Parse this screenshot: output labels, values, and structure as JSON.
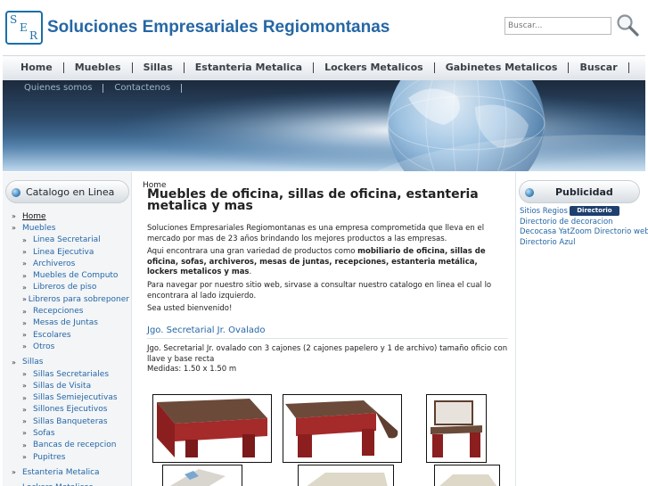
{
  "header": {
    "logo_letters": [
      "S",
      "E",
      "R"
    ],
    "title": "Soluciones Empresariales Regiomontanas",
    "search_placeholder": "Buscar...",
    "search_icon": "magnifier-icon"
  },
  "nav": {
    "row1": [
      "Home",
      "Muebles",
      "Sillas",
      "Estanteria Metalica",
      "Lockers Metalicos",
      "Gabinetes Metalicos",
      "Buscar"
    ],
    "row2": [
      "Quienes somos",
      "Contactenos"
    ]
  },
  "sidebar": {
    "heading": "Catalogo en Linea",
    "items": [
      {
        "label": "Home",
        "level": 0,
        "active": true
      },
      {
        "label": "Muebles",
        "level": 0
      },
      {
        "label": "Linea Secretarial",
        "level": 1
      },
      {
        "label": "Linea Ejecutiva",
        "level": 1
      },
      {
        "label": "Archiveros",
        "level": 1
      },
      {
        "label": "Muebles de Computo",
        "level": 1
      },
      {
        "label": "Libreros de piso",
        "level": 1
      },
      {
        "label": "Libreros para sobreponer",
        "level": 1
      },
      {
        "label": "Recepciones",
        "level": 1
      },
      {
        "label": "Mesas de Juntas",
        "level": 1
      },
      {
        "label": "Escolares",
        "level": 1
      },
      {
        "label": "Otros",
        "level": 1
      },
      {
        "label": "Sillas",
        "level": 0
      },
      {
        "label": "Sillas Secretariales",
        "level": 1
      },
      {
        "label": "Sillas de Visita",
        "level": 1
      },
      {
        "label": "Sillas Semiejecutivas",
        "level": 1
      },
      {
        "label": "Sillones Ejecutivos",
        "level": 1
      },
      {
        "label": "Sillas Banqueteras",
        "level": 1
      },
      {
        "label": "Sofas",
        "level": 1
      },
      {
        "label": "Bancas de recepcion",
        "level": 1
      },
      {
        "label": "Pupitres",
        "level": 1
      },
      {
        "label": "Estanteria Metalica",
        "level": 0
      },
      {
        "label": "Lockers Metalicos",
        "level": 0
      }
    ]
  },
  "main": {
    "breadcrumb": "Home",
    "title": "Muebles de oficina, sillas de oficina, estanteria metalica y mas",
    "intro": "Soluciones Empresariales Regiomontanas es una empresa comprometida que lleva en el mercado por mas de 23 años brindando los mejores productos a las empresas.",
    "offer_prefix": "Aqui encontrara una gran variedad de productos como ",
    "offer_bold": "mobiliario de oficina, sillas de oficina, sofas, archiveros, mesas de juntas, recepciones, estanteria metálica, lockers metalicos y mas",
    "offer_suffix": ".",
    "navigate": "Para navegar por nuestro sitio web, sirvase a consultar nuestro catalogo en linea el cual lo encontrara al lado izquierdo.",
    "welcome": "Sea usted bienvenido!",
    "product": {
      "title": "Jgo. Secretarial Jr. Ovalado",
      "description": "Jgo. Secretarial Jr. ovalado con 3 cajones (2 cajones papelero y 1 de archivo) tamaño oficio con llave y base recta",
      "measures": "Medidas: 1.50 x 1.50 m"
    }
  },
  "right": {
    "heading": "Publicidad",
    "links": [
      "Sitios Regios",
      "Directorio de decoracion",
      "Decocasa YatZoom Directorio web",
      "Directorio Azul"
    ],
    "badge": "Directorio"
  },
  "colors": {
    "brand_blue": "#2567a5",
    "desk_red": "#8b1f1f",
    "desk_top": "#6b4a3a"
  }
}
